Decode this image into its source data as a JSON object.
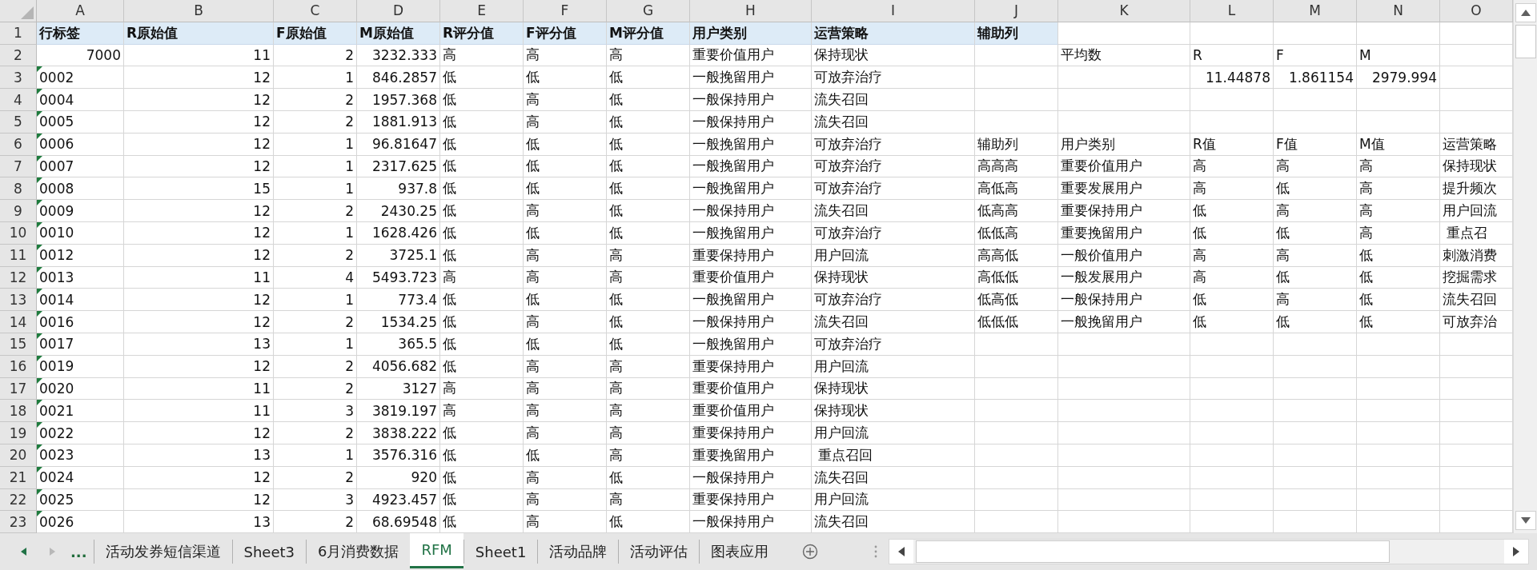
{
  "column_headers": [
    "A",
    "B",
    "C",
    "D",
    "E",
    "F",
    "G",
    "H",
    "I",
    "J",
    "K",
    "L",
    "M",
    "N",
    "O"
  ],
  "rows": [
    {
      "number": "1",
      "cells": [
        {
          "kind": "header",
          "value": "行标签"
        },
        {
          "kind": "header",
          "value": "R原始值"
        },
        {
          "kind": "header",
          "value": "F原始值"
        },
        {
          "kind": "header",
          "value": "M原始值"
        },
        {
          "kind": "header",
          "value": "R评分值"
        },
        {
          "kind": "header",
          "value": "F评分值"
        },
        {
          "kind": "header",
          "value": "M评分值"
        },
        {
          "kind": "header",
          "value": "用户类别"
        },
        {
          "kind": "header",
          "value": "运营策略"
        },
        {
          "kind": "header",
          "value": "辅助列"
        }
      ]
    },
    {
      "number": "2",
      "cells": [
        {
          "kind": "number",
          "value": "7000"
        },
        {
          "kind": "number",
          "value": "11"
        },
        {
          "kind": "number",
          "value": "2"
        },
        {
          "kind": "number",
          "value": "3232.333"
        },
        {
          "kind": "text",
          "value": "高"
        },
        {
          "kind": "text",
          "value": "高"
        },
        {
          "kind": "text",
          "value": "高"
        },
        {
          "kind": "text",
          "value": "重要价值用户"
        },
        {
          "kind": "text",
          "value": "保持现状"
        },
        null,
        {
          "kind": "text",
          "value": "平均数"
        },
        {
          "kind": "text",
          "value": "R"
        },
        {
          "kind": "text",
          "value": "F"
        },
        {
          "kind": "text",
          "value": "M"
        }
      ]
    },
    {
      "number": "3",
      "cells": [
        {
          "kind": "numeric_text",
          "value": "0002"
        },
        {
          "kind": "number",
          "value": "12"
        },
        {
          "kind": "number",
          "value": "1"
        },
        {
          "kind": "number",
          "value": "846.2857"
        },
        {
          "kind": "text",
          "value": "低"
        },
        {
          "kind": "text",
          "value": "低"
        },
        {
          "kind": "text",
          "value": "低"
        },
        {
          "kind": "text",
          "value": "一般挽留用户"
        },
        {
          "kind": "text",
          "value": "可放弃治疗"
        },
        null,
        null,
        {
          "kind": "number",
          "value": "11.44878"
        },
        {
          "kind": "number",
          "value": "1.861154"
        },
        {
          "kind": "number",
          "value": "2979.994"
        }
      ]
    },
    {
      "number": "4",
      "cells": [
        {
          "kind": "numeric_text",
          "value": "0004"
        },
        {
          "kind": "number",
          "value": "12"
        },
        {
          "kind": "number",
          "value": "2"
        },
        {
          "kind": "number",
          "value": "1957.368"
        },
        {
          "kind": "text",
          "value": "低"
        },
        {
          "kind": "text",
          "value": "高"
        },
        {
          "kind": "text",
          "value": "低"
        },
        {
          "kind": "text",
          "value": "一般保持用户"
        },
        {
          "kind": "text",
          "value": "流失召回"
        }
      ]
    },
    {
      "number": "5",
      "cells": [
        {
          "kind": "numeric_text",
          "value": "0005"
        },
        {
          "kind": "number",
          "value": "12"
        },
        {
          "kind": "number",
          "value": "2"
        },
        {
          "kind": "number",
          "value": "1881.913"
        },
        {
          "kind": "text",
          "value": "低"
        },
        {
          "kind": "text",
          "value": "高"
        },
        {
          "kind": "text",
          "value": "低"
        },
        {
          "kind": "text",
          "value": "一般保持用户"
        },
        {
          "kind": "text",
          "value": "流失召回"
        }
      ]
    },
    {
      "number": "6",
      "cells": [
        {
          "kind": "numeric_text",
          "value": "0006"
        },
        {
          "kind": "number",
          "value": "12"
        },
        {
          "kind": "number",
          "value": "1"
        },
        {
          "kind": "number",
          "value": "96.81647"
        },
        {
          "kind": "text",
          "value": "低"
        },
        {
          "kind": "text",
          "value": "低"
        },
        {
          "kind": "text",
          "value": "低"
        },
        {
          "kind": "text",
          "value": "一般挽留用户"
        },
        {
          "kind": "text",
          "value": "可放弃治疗"
        },
        {
          "kind": "text",
          "value": "辅助列"
        },
        {
          "kind": "text",
          "value": "用户类别"
        },
        {
          "kind": "text",
          "value": "R值"
        },
        {
          "kind": "text",
          "value": "F值"
        },
        {
          "kind": "text",
          "value": "M值"
        },
        {
          "kind": "text",
          "value": "运营策略"
        }
      ]
    },
    {
      "number": "7",
      "cells": [
        {
          "kind": "numeric_text",
          "value": "0007"
        },
        {
          "kind": "number",
          "value": "12"
        },
        {
          "kind": "number",
          "value": "1"
        },
        {
          "kind": "number",
          "value": "2317.625"
        },
        {
          "kind": "text",
          "value": "低"
        },
        {
          "kind": "text",
          "value": "低"
        },
        {
          "kind": "text",
          "value": "低"
        },
        {
          "kind": "text",
          "value": "一般挽留用户"
        },
        {
          "kind": "text",
          "value": "可放弃治疗"
        },
        {
          "kind": "text",
          "value": "高高高"
        },
        {
          "kind": "text",
          "value": "重要价值用户"
        },
        {
          "kind": "text",
          "value": "高"
        },
        {
          "kind": "text",
          "value": "高"
        },
        {
          "kind": "text",
          "value": "高"
        },
        {
          "kind": "text",
          "value": "保持现状"
        }
      ]
    },
    {
      "number": "8",
      "cells": [
        {
          "kind": "numeric_text",
          "value": "0008"
        },
        {
          "kind": "number",
          "value": "15"
        },
        {
          "kind": "number",
          "value": "1"
        },
        {
          "kind": "number",
          "value": "937.8"
        },
        {
          "kind": "text",
          "value": "低"
        },
        {
          "kind": "text",
          "value": "低"
        },
        {
          "kind": "text",
          "value": "低"
        },
        {
          "kind": "text",
          "value": "一般挽留用户"
        },
        {
          "kind": "text",
          "value": "可放弃治疗"
        },
        {
          "kind": "text",
          "value": "高低高"
        },
        {
          "kind": "text",
          "value": "重要发展用户"
        },
        {
          "kind": "text",
          "value": "高"
        },
        {
          "kind": "text",
          "value": "低"
        },
        {
          "kind": "text",
          "value": "高"
        },
        {
          "kind": "text",
          "value": "提升频次"
        }
      ]
    },
    {
      "number": "9",
      "cells": [
        {
          "kind": "numeric_text",
          "value": "0009"
        },
        {
          "kind": "number",
          "value": "12"
        },
        {
          "kind": "number",
          "value": "2"
        },
        {
          "kind": "number",
          "value": "2430.25"
        },
        {
          "kind": "text",
          "value": "低"
        },
        {
          "kind": "text",
          "value": "高"
        },
        {
          "kind": "text",
          "value": "低"
        },
        {
          "kind": "text",
          "value": "一般保持用户"
        },
        {
          "kind": "text",
          "value": "流失召回"
        },
        {
          "kind": "text",
          "value": "低高高"
        },
        {
          "kind": "text",
          "value": "重要保持用户"
        },
        {
          "kind": "text",
          "value": "低"
        },
        {
          "kind": "text",
          "value": "高"
        },
        {
          "kind": "text",
          "value": "高"
        },
        {
          "kind": "text",
          "value": "用户回流"
        }
      ]
    },
    {
      "number": "10",
      "cells": [
        {
          "kind": "numeric_text",
          "value": "0010"
        },
        {
          "kind": "number",
          "value": "12"
        },
        {
          "kind": "number",
          "value": "1"
        },
        {
          "kind": "number",
          "value": "1628.426"
        },
        {
          "kind": "text",
          "value": "低"
        },
        {
          "kind": "text",
          "value": "低"
        },
        {
          "kind": "text",
          "value": "低"
        },
        {
          "kind": "text",
          "value": "一般挽留用户"
        },
        {
          "kind": "text",
          "value": "可放弃治疗"
        },
        {
          "kind": "text",
          "value": "低低高"
        },
        {
          "kind": "text",
          "value": "重要挽留用户"
        },
        {
          "kind": "text",
          "value": "低"
        },
        {
          "kind": "text",
          "value": "低"
        },
        {
          "kind": "text",
          "value": "高"
        },
        {
          "kind": "text",
          "value": " 重点召"
        }
      ]
    },
    {
      "number": "11",
      "cells": [
        {
          "kind": "numeric_text",
          "value": "0012"
        },
        {
          "kind": "number",
          "value": "12"
        },
        {
          "kind": "number",
          "value": "2"
        },
        {
          "kind": "number",
          "value": "3725.1"
        },
        {
          "kind": "text",
          "value": "低"
        },
        {
          "kind": "text",
          "value": "高"
        },
        {
          "kind": "text",
          "value": "高"
        },
        {
          "kind": "text",
          "value": "重要保持用户"
        },
        {
          "kind": "text",
          "value": "用户回流"
        },
        {
          "kind": "text",
          "value": "高高低"
        },
        {
          "kind": "text",
          "value": "一般价值用户"
        },
        {
          "kind": "text",
          "value": "高"
        },
        {
          "kind": "text",
          "value": "高"
        },
        {
          "kind": "text",
          "value": "低"
        },
        {
          "kind": "text",
          "value": "刺激消费"
        }
      ]
    },
    {
      "number": "12",
      "cells": [
        {
          "kind": "numeric_text",
          "value": "0013"
        },
        {
          "kind": "number",
          "value": "11"
        },
        {
          "kind": "number",
          "value": "4"
        },
        {
          "kind": "number",
          "value": "5493.723"
        },
        {
          "kind": "text",
          "value": "高"
        },
        {
          "kind": "text",
          "value": "高"
        },
        {
          "kind": "text",
          "value": "高"
        },
        {
          "kind": "text",
          "value": "重要价值用户"
        },
        {
          "kind": "text",
          "value": "保持现状"
        },
        {
          "kind": "text",
          "value": "高低低"
        },
        {
          "kind": "text",
          "value": "一般发展用户"
        },
        {
          "kind": "text",
          "value": "高"
        },
        {
          "kind": "text",
          "value": "低"
        },
        {
          "kind": "text",
          "value": "低"
        },
        {
          "kind": "text",
          "value": "挖掘需求"
        }
      ]
    },
    {
      "number": "13",
      "cells": [
        {
          "kind": "numeric_text",
          "value": "0014"
        },
        {
          "kind": "number",
          "value": "12"
        },
        {
          "kind": "number",
          "value": "1"
        },
        {
          "kind": "number",
          "value": "773.4"
        },
        {
          "kind": "text",
          "value": "低"
        },
        {
          "kind": "text",
          "value": "低"
        },
        {
          "kind": "text",
          "value": "低"
        },
        {
          "kind": "text",
          "value": "一般挽留用户"
        },
        {
          "kind": "text",
          "value": "可放弃治疗"
        },
        {
          "kind": "text",
          "value": "低高低"
        },
        {
          "kind": "text",
          "value": "一般保持用户"
        },
        {
          "kind": "text",
          "value": "低"
        },
        {
          "kind": "text",
          "value": "高"
        },
        {
          "kind": "text",
          "value": "低"
        },
        {
          "kind": "text",
          "value": "流失召回"
        }
      ]
    },
    {
      "number": "14",
      "cells": [
        {
          "kind": "numeric_text",
          "value": "0016"
        },
        {
          "kind": "number",
          "value": "12"
        },
        {
          "kind": "number",
          "value": "2"
        },
        {
          "kind": "number",
          "value": "1534.25"
        },
        {
          "kind": "text",
          "value": "低"
        },
        {
          "kind": "text",
          "value": "高"
        },
        {
          "kind": "text",
          "value": "低"
        },
        {
          "kind": "text",
          "value": "一般保持用户"
        },
        {
          "kind": "text",
          "value": "流失召回"
        },
        {
          "kind": "text",
          "value": "低低低"
        },
        {
          "kind": "text",
          "value": "一般挽留用户"
        },
        {
          "kind": "text",
          "value": "低"
        },
        {
          "kind": "text",
          "value": "低"
        },
        {
          "kind": "text",
          "value": "低"
        },
        {
          "kind": "text",
          "value": "可放弃治"
        }
      ]
    },
    {
      "number": "15",
      "cells": [
        {
          "kind": "numeric_text",
          "value": "0017"
        },
        {
          "kind": "number",
          "value": "13"
        },
        {
          "kind": "number",
          "value": "1"
        },
        {
          "kind": "number",
          "value": "365.5"
        },
        {
          "kind": "text",
          "value": "低"
        },
        {
          "kind": "text",
          "value": "低"
        },
        {
          "kind": "text",
          "value": "低"
        },
        {
          "kind": "text",
          "value": "一般挽留用户"
        },
        {
          "kind": "text",
          "value": "可放弃治疗"
        }
      ]
    },
    {
      "number": "16",
      "cells": [
        {
          "kind": "numeric_text",
          "value": "0019"
        },
        {
          "kind": "number",
          "value": "12"
        },
        {
          "kind": "number",
          "value": "2"
        },
        {
          "kind": "number",
          "value": "4056.682"
        },
        {
          "kind": "text",
          "value": "低"
        },
        {
          "kind": "text",
          "value": "高"
        },
        {
          "kind": "text",
          "value": "高"
        },
        {
          "kind": "text",
          "value": "重要保持用户"
        },
        {
          "kind": "text",
          "value": "用户回流"
        }
      ]
    },
    {
      "number": "17",
      "cells": [
        {
          "kind": "numeric_text",
          "value": "0020"
        },
        {
          "kind": "number",
          "value": "11"
        },
        {
          "kind": "number",
          "value": "2"
        },
        {
          "kind": "number",
          "value": "3127"
        },
        {
          "kind": "text",
          "value": "高"
        },
        {
          "kind": "text",
          "value": "高"
        },
        {
          "kind": "text",
          "value": "高"
        },
        {
          "kind": "text",
          "value": "重要价值用户"
        },
        {
          "kind": "text",
          "value": "保持现状"
        }
      ]
    },
    {
      "number": "18",
      "cells": [
        {
          "kind": "numeric_text",
          "value": "0021"
        },
        {
          "kind": "number",
          "value": "11"
        },
        {
          "kind": "number",
          "value": "3"
        },
        {
          "kind": "number",
          "value": "3819.197"
        },
        {
          "kind": "text",
          "value": "高"
        },
        {
          "kind": "text",
          "value": "高"
        },
        {
          "kind": "text",
          "value": "高"
        },
        {
          "kind": "text",
          "value": "重要价值用户"
        },
        {
          "kind": "text",
          "value": "保持现状"
        }
      ]
    },
    {
      "number": "19",
      "cells": [
        {
          "kind": "numeric_text",
          "value": "0022"
        },
        {
          "kind": "number",
          "value": "12"
        },
        {
          "kind": "number",
          "value": "2"
        },
        {
          "kind": "number",
          "value": "3838.222"
        },
        {
          "kind": "text",
          "value": "低"
        },
        {
          "kind": "text",
          "value": "高"
        },
        {
          "kind": "text",
          "value": "高"
        },
        {
          "kind": "text",
          "value": "重要保持用户"
        },
        {
          "kind": "text",
          "value": "用户回流"
        }
      ]
    },
    {
      "number": "20",
      "cells": [
        {
          "kind": "numeric_text",
          "value": "0023"
        },
        {
          "kind": "number",
          "value": "13"
        },
        {
          "kind": "number",
          "value": "1"
        },
        {
          "kind": "number",
          "value": "3576.316"
        },
        {
          "kind": "text",
          "value": "低"
        },
        {
          "kind": "text",
          "value": "低"
        },
        {
          "kind": "text",
          "value": "高"
        },
        {
          "kind": "text",
          "value": "重要挽留用户"
        },
        {
          "kind": "text",
          "value": " 重点召回"
        }
      ]
    },
    {
      "number": "21",
      "cells": [
        {
          "kind": "numeric_text",
          "value": "0024"
        },
        {
          "kind": "number",
          "value": "12"
        },
        {
          "kind": "number",
          "value": "2"
        },
        {
          "kind": "number",
          "value": "920"
        },
        {
          "kind": "text",
          "value": "低"
        },
        {
          "kind": "text",
          "value": "高"
        },
        {
          "kind": "text",
          "value": "低"
        },
        {
          "kind": "text",
          "value": "一般保持用户"
        },
        {
          "kind": "text",
          "value": "流失召回"
        }
      ]
    },
    {
      "number": "22",
      "cells": [
        {
          "kind": "numeric_text",
          "value": "0025"
        },
        {
          "kind": "number",
          "value": "12"
        },
        {
          "kind": "number",
          "value": "3"
        },
        {
          "kind": "number",
          "value": "4923.457"
        },
        {
          "kind": "text",
          "value": "低"
        },
        {
          "kind": "text",
          "value": "高"
        },
        {
          "kind": "text",
          "value": "高"
        },
        {
          "kind": "text",
          "value": "重要保持用户"
        },
        {
          "kind": "text",
          "value": "用户回流"
        }
      ]
    },
    {
      "number": "23",
      "cells": [
        {
          "kind": "numeric_text",
          "value": "0026"
        },
        {
          "kind": "number",
          "value": "13"
        },
        {
          "kind": "number",
          "value": "2"
        },
        {
          "kind": "number",
          "value": "68.69548"
        },
        {
          "kind": "text",
          "value": "低"
        },
        {
          "kind": "text",
          "value": "高"
        },
        {
          "kind": "text",
          "value": "低"
        },
        {
          "kind": "text",
          "value": "一般保持用户"
        },
        {
          "kind": "text",
          "value": "流失召回"
        }
      ]
    }
  ],
  "sheet_tabs": {
    "overflow": "...",
    "tabs": [
      {
        "label": "活动发券短信渠道",
        "selected": false
      },
      {
        "label": "Sheet3",
        "selected": false
      },
      {
        "label": "6月消费数据",
        "selected": false
      },
      {
        "label": "RFM",
        "selected": true
      },
      {
        "label": "Sheet1",
        "selected": false
      },
      {
        "label": "活动品牌",
        "selected": false
      },
      {
        "label": "活动评估",
        "selected": false
      },
      {
        "label": "图表应用",
        "selected": false
      }
    ]
  }
}
